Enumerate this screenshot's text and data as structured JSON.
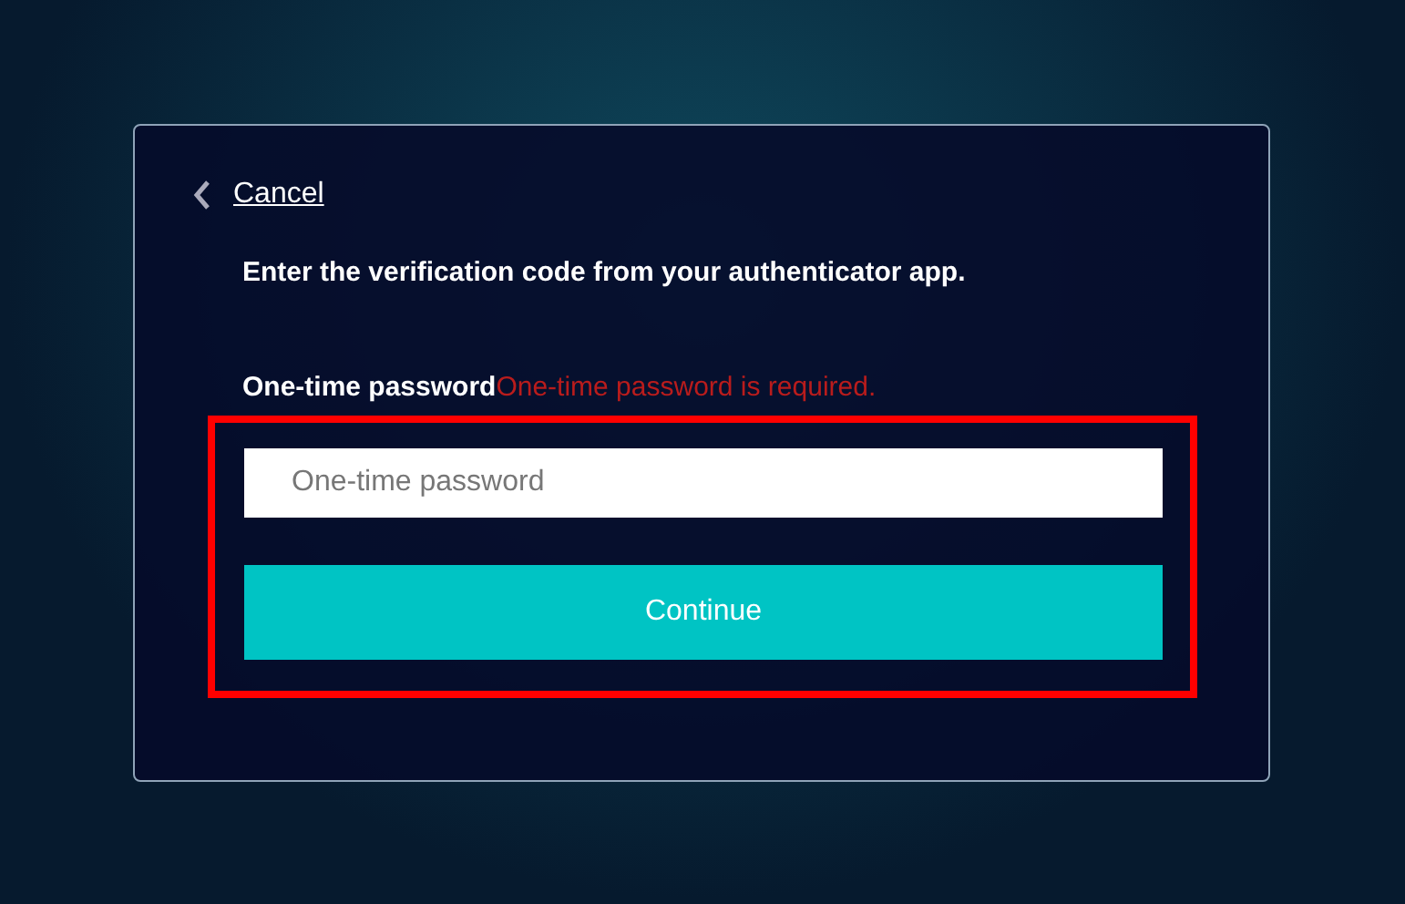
{
  "dialog": {
    "cancel_link": "Cancel",
    "instruction": "Enter the verification code from your authenticator app.",
    "field_label": "One-time password",
    "error_message": "One-time password is required.",
    "otp_field": {
      "placeholder": "One-time password"
    },
    "continue_button": "Continue",
    "highlighted": true
  }
}
